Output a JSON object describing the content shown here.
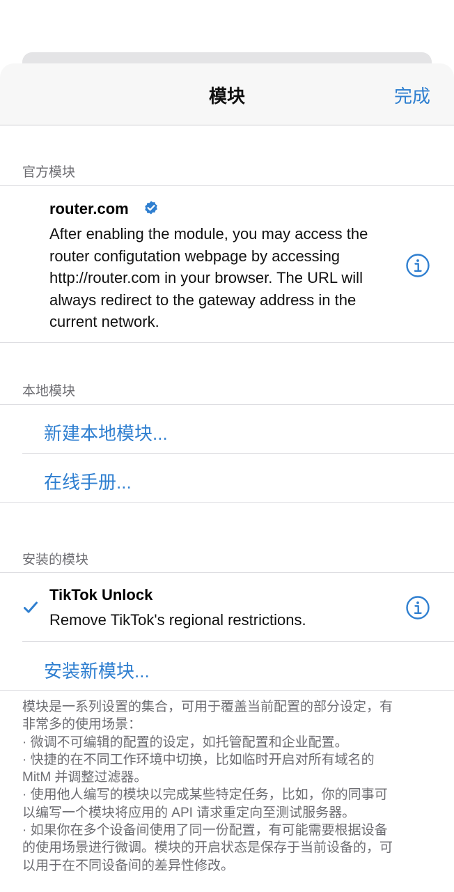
{
  "nav": {
    "title": "模块",
    "done_label": "完成"
  },
  "sections": {
    "official": {
      "header": "官方模块",
      "module": {
        "title": "router.com",
        "description_lines": [
          "After enabling the module, you may access the",
          "router configutation webpage by accessing",
          "http://router.com in your browser. The URL will",
          "always redirect to the gateway address in the",
          "current network."
        ]
      }
    },
    "local": {
      "header": "本地模块",
      "new_local_label": "新建本地模块...",
      "manual_label": "在线手册..."
    },
    "installed": {
      "header": "安装的模块",
      "module": {
        "title": "TikTok Unlock",
        "description": "Remove TikTok's regional restrictions."
      },
      "install_new_label": "安装新模块..."
    }
  },
  "footer_lines": [
    "模块是一系列设置的集合，可用于覆盖当前配置的部分设定，有",
    "非常多的使用场景：",
    "· 微调不可编辑的配置的设定，如托管配置和企业配置。",
    "· 快捷的在不同工作环境中切换，比如临时开启对所有域名的",
    "MitM 并调整过滤器。",
    "· 使用他人编写的模块以完成某些特定任务，比如，你的同事可",
    "以编写一个模块将应用的 API 请求重定向至测试服务器。",
    "· 如果你在多个设备间使用了同一份配置，有可能需要根据设备",
    "的使用场景进行微调。模块的开启状态是保存于当前设备的，可",
    "以用于在不同设备间的差异性修改。"
  ],
  "colors": {
    "accent": "#2f7fd0",
    "secondary_text": "#6d6d72",
    "separator": "#dedee2"
  },
  "icons": [
    "verified-badge-icon",
    "info-icon",
    "checkmark-icon"
  ]
}
